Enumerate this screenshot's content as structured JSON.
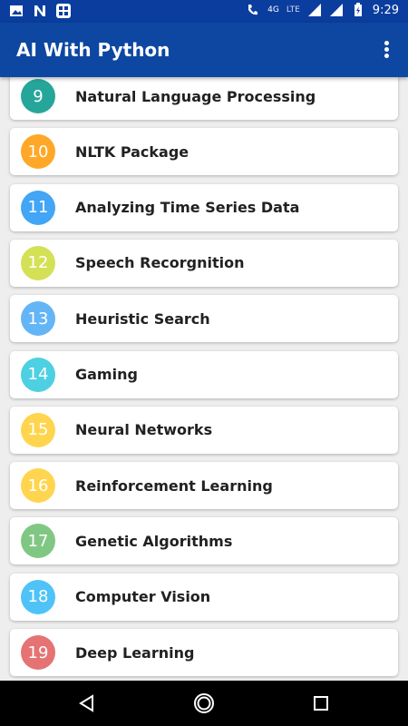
{
  "status_bar": {
    "network_label": "4G",
    "lte_label": "LTE",
    "time": "9:29"
  },
  "app_bar": {
    "title": "AI With Python",
    "overflow_icon": "more-vert-icon"
  },
  "topics": [
    {
      "number": "9",
      "title": "Natural Language Processing",
      "color": "#26a69a"
    },
    {
      "number": "10",
      "title": "NLTK Package",
      "color": "#ffa726"
    },
    {
      "number": "11",
      "title": "Analyzing Time Series Data",
      "color": "#42a5f5"
    },
    {
      "number": "12",
      "title": "Speech Recorgnition",
      "color": "#d4e157"
    },
    {
      "number": "13",
      "title": "Heuristic Search",
      "color": "#64b5f6"
    },
    {
      "number": "14",
      "title": "Gaming",
      "color": "#4dd0e1"
    },
    {
      "number": "15",
      "title": "Neural Networks",
      "color": "#ffd54f"
    },
    {
      "number": "16",
      "title": "Reinforcement Learning",
      "color": "#ffd54f"
    },
    {
      "number": "17",
      "title": "Genetic Algorithms",
      "color": "#81c784"
    },
    {
      "number": "18",
      "title": "Computer Vision",
      "color": "#4fc3f7"
    },
    {
      "number": "19",
      "title": "Deep Learning",
      "color": "#e57373"
    }
  ],
  "nav_bar": {
    "back_icon": "back-triangle-icon",
    "home_icon": "home-circle-icon",
    "recents_icon": "recents-square-icon"
  }
}
